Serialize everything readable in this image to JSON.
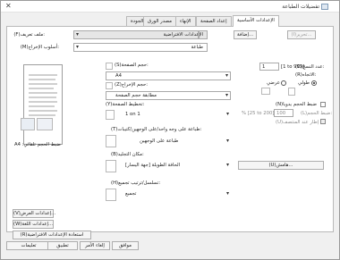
{
  "window": {
    "title": "تفضيلات الطباعة"
  },
  "tabs": [
    "الإعدادات الأساسية",
    "إعداد الصفحة",
    "الإنهاء",
    "مصدر الورق",
    "الجودة"
  ],
  "profile": {
    "label": "(F)ملف تعريف:",
    "value": "الإعدادات الافتراضية",
    "add": "إضافة...",
    "edit": "(I)تحرير...",
    "output_label": "(M)أسلوب الإخراج:",
    "output_value": "طباعة"
  },
  "page": {
    "page_size_label": "(S)حجم الصفحة:",
    "page_size_value": "A4",
    "output_size_label": "(Z)حجم الإخراج:",
    "output_size_value": "مطابقة حجم الصفحة",
    "layout_label": "(Y)تخطيط الصفحة:",
    "layout_value": "1 on 1",
    "duplex_label": "(T)طباعة على وجه واحد/على الوجهين/كتيبات:",
    "duplex_value": "طباعة على الوجهين",
    "binding_label": "(B)مكان التجليد:",
    "binding_value": "الحافة الطويلة [جهة اليسار]",
    "collate_label": "(H)تسلسل/ترتيب تجميع:",
    "collate_value": "تجميع",
    "preview_caption": "A4 :ضبط الحجم تلقائي"
  },
  "copies": {
    "label": "(C)عدد النسخ:",
    "value": "1",
    "range": "[1 to 999]"
  },
  "orientation": {
    "label": "(R)الاتجاه:",
    "portrait": "طولي",
    "landscape": "عرضي",
    "selected": "portrait"
  },
  "scaling": {
    "manual_label": "(N)ضبط الحجم يدويا",
    "scale_label": "(L)ضبط الحجم:",
    "scale_value": "100",
    "scale_range": "% [25 to 200]",
    "frame_label": "(U)إطار عند المنتصف"
  },
  "buttons": {
    "margins": "(U)هامش...",
    "view_settings": "(V)إعدادات العرض...",
    "language_settings": "(W)إعدادات اللغة...",
    "restore_defaults": "(R)استعادة الإعدادات الافتراضية",
    "ok": "موافق",
    "cancel": "إلغاء الأمر",
    "apply": "تطبيق",
    "help": "تعليمات"
  }
}
